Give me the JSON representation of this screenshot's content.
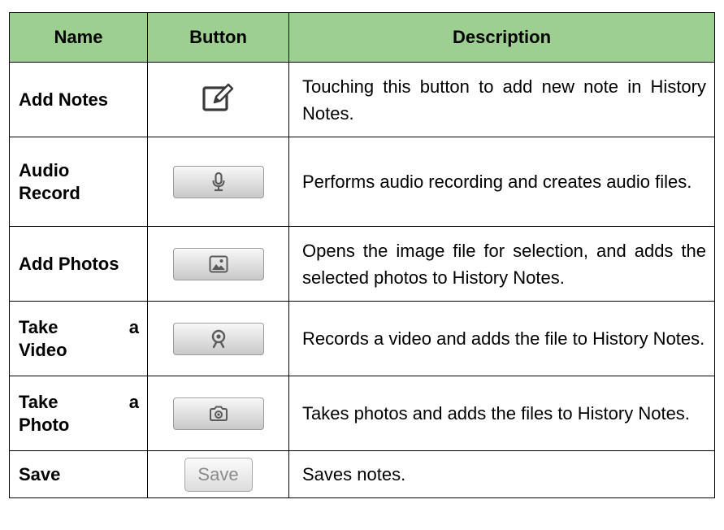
{
  "header": {
    "name": "Name",
    "button": "Button",
    "description": "Description"
  },
  "rows": [
    {
      "name_lines": [
        "Add Notes"
      ],
      "icon": "edit-note-icon",
      "description": "Touching this button to add new note in History Notes."
    },
    {
      "name_lines": [
        "Audio",
        "Record"
      ],
      "icon": "microphone-icon",
      "description": "Performs audio recording and creates audio files."
    },
    {
      "name_lines": [
        "Add Photos"
      ],
      "icon": "image-icon",
      "description": "Opens the image file for selection, and adds the selected photos to History Notes."
    },
    {
      "name_lines": [
        "Take a",
        "Video"
      ],
      "icon": "webcam-icon",
      "description": "Records a video and adds the file to History Notes."
    },
    {
      "name_lines": [
        "Take a",
        "Photo"
      ],
      "icon": "camera-icon",
      "description": "Takes photos and adds the files to History Notes."
    },
    {
      "name_lines": [
        "Save"
      ],
      "button_label": "Save",
      "description": "Saves notes."
    }
  ]
}
